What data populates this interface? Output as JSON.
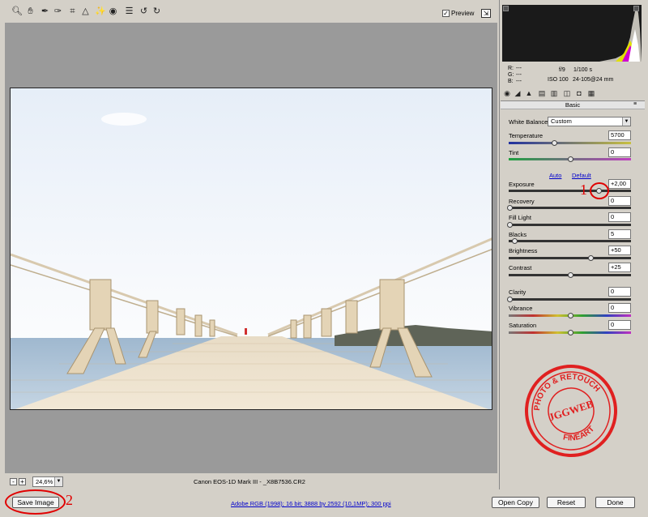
{
  "toolbar": {
    "tools": [
      "zoom-icon",
      "hand-icon",
      "white-balance-icon",
      "color-sampler-icon",
      "crop-icon",
      "straighten-icon",
      "retouch-icon",
      "red-eye-icon",
      "preferences-icon",
      "rotate-left-icon",
      "rotate-right-icon"
    ],
    "preview_label": "Preview",
    "preview_checked": "✓"
  },
  "status": {
    "zoom_out": "-",
    "zoom_in": "+",
    "zoom_value": "24,6%",
    "camera_info": "Canon EOS-1D Mark III  -  _X8B7536.CR2"
  },
  "bottom": {
    "save_label": "Save Image",
    "workflow": "Adobe RGB (1998); 16 bit; 3888 by 2592 (10,1MP); 300 ppi",
    "open_label": "Open Copy",
    "reset_label": "Reset",
    "done_label": "Done"
  },
  "readout": {
    "r_label": "R:",
    "r_value": "---",
    "g_label": "G:",
    "g_value": "---",
    "b_label": "B:",
    "b_value": "---",
    "aperture": "f/9",
    "shutter": "1/100 s",
    "iso": "ISO 100",
    "lens": "24-105@24 mm"
  },
  "panel": {
    "title": "Basic",
    "menu_icon": "≡",
    "white_balance_label": "White Balance:",
    "white_balance_value": "Custom",
    "auto_label": "Auto",
    "default_label": "Default",
    "sliders": {
      "temperature": {
        "label": "Temperature",
        "value": "5700"
      },
      "tint": {
        "label": "Tint",
        "value": "0"
      },
      "exposure": {
        "label": "Exposure",
        "value": "+2,00"
      },
      "recovery": {
        "label": "Recovery",
        "value": "0"
      },
      "fill_light": {
        "label": "Fill Light",
        "value": "0"
      },
      "blacks": {
        "label": "Blacks",
        "value": "5"
      },
      "brightness": {
        "label": "Brightness",
        "value": "+50"
      },
      "contrast": {
        "label": "Contrast",
        "value": "+25"
      },
      "clarity": {
        "label": "Clarity",
        "value": "0"
      },
      "vibrance": {
        "label": "Vibrance",
        "value": "0"
      },
      "saturation": {
        "label": "Saturation",
        "value": "0"
      }
    }
  },
  "annotations": {
    "step1": "1",
    "step2": "2"
  },
  "watermark": {
    "top_text": "PHOTO & RETOUCH",
    "center_text": "JGGWEB",
    "bottom_text": "FINEART"
  },
  "colors": {
    "annotation": "#e00000",
    "link": "#0000cc",
    "panel_bg": "#d4d0c8",
    "canvas_bg": "#9a9a9a"
  }
}
